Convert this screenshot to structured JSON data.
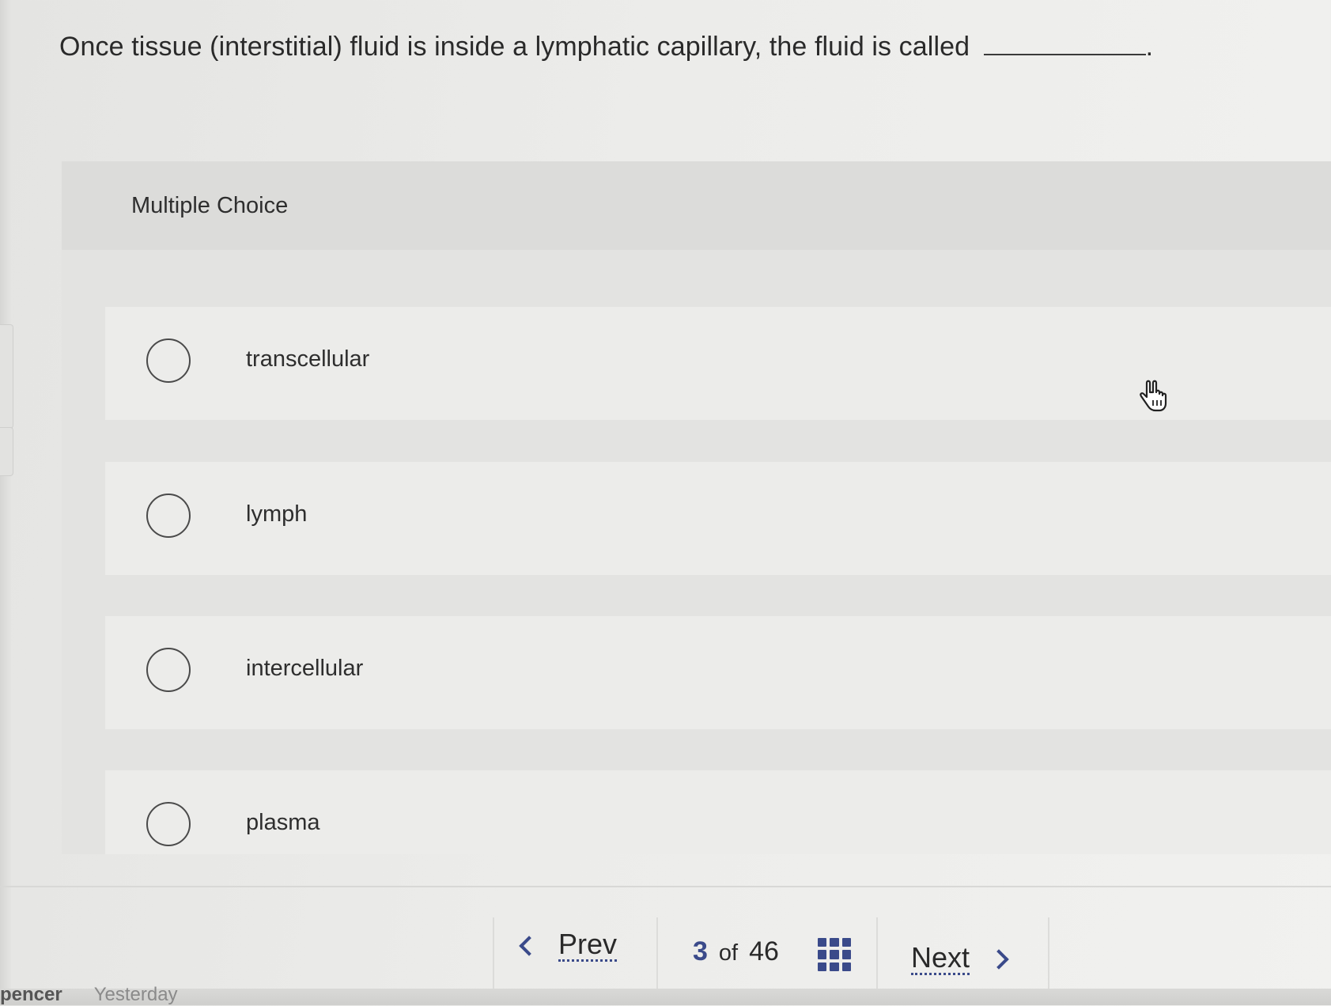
{
  "question": {
    "text": "Once tissue (interstitial) fluid is inside a lymphatic capillary, the fluid is called",
    "trailing": "."
  },
  "multiple_choice": {
    "label": "Multiple Choice",
    "options": [
      {
        "label": "transcellular"
      },
      {
        "label": "lymph"
      },
      {
        "label": "intercellular"
      },
      {
        "label": "plasma"
      }
    ]
  },
  "navigation": {
    "prev_label": "Prev",
    "current": "3",
    "of_label": "of",
    "total": "46",
    "next_label": "Next",
    "grid_icon": "grid-icon",
    "accent_color": "#3a4a8a"
  },
  "footer": {
    "name_fragment": "pencer",
    "date": "Yesterday"
  }
}
